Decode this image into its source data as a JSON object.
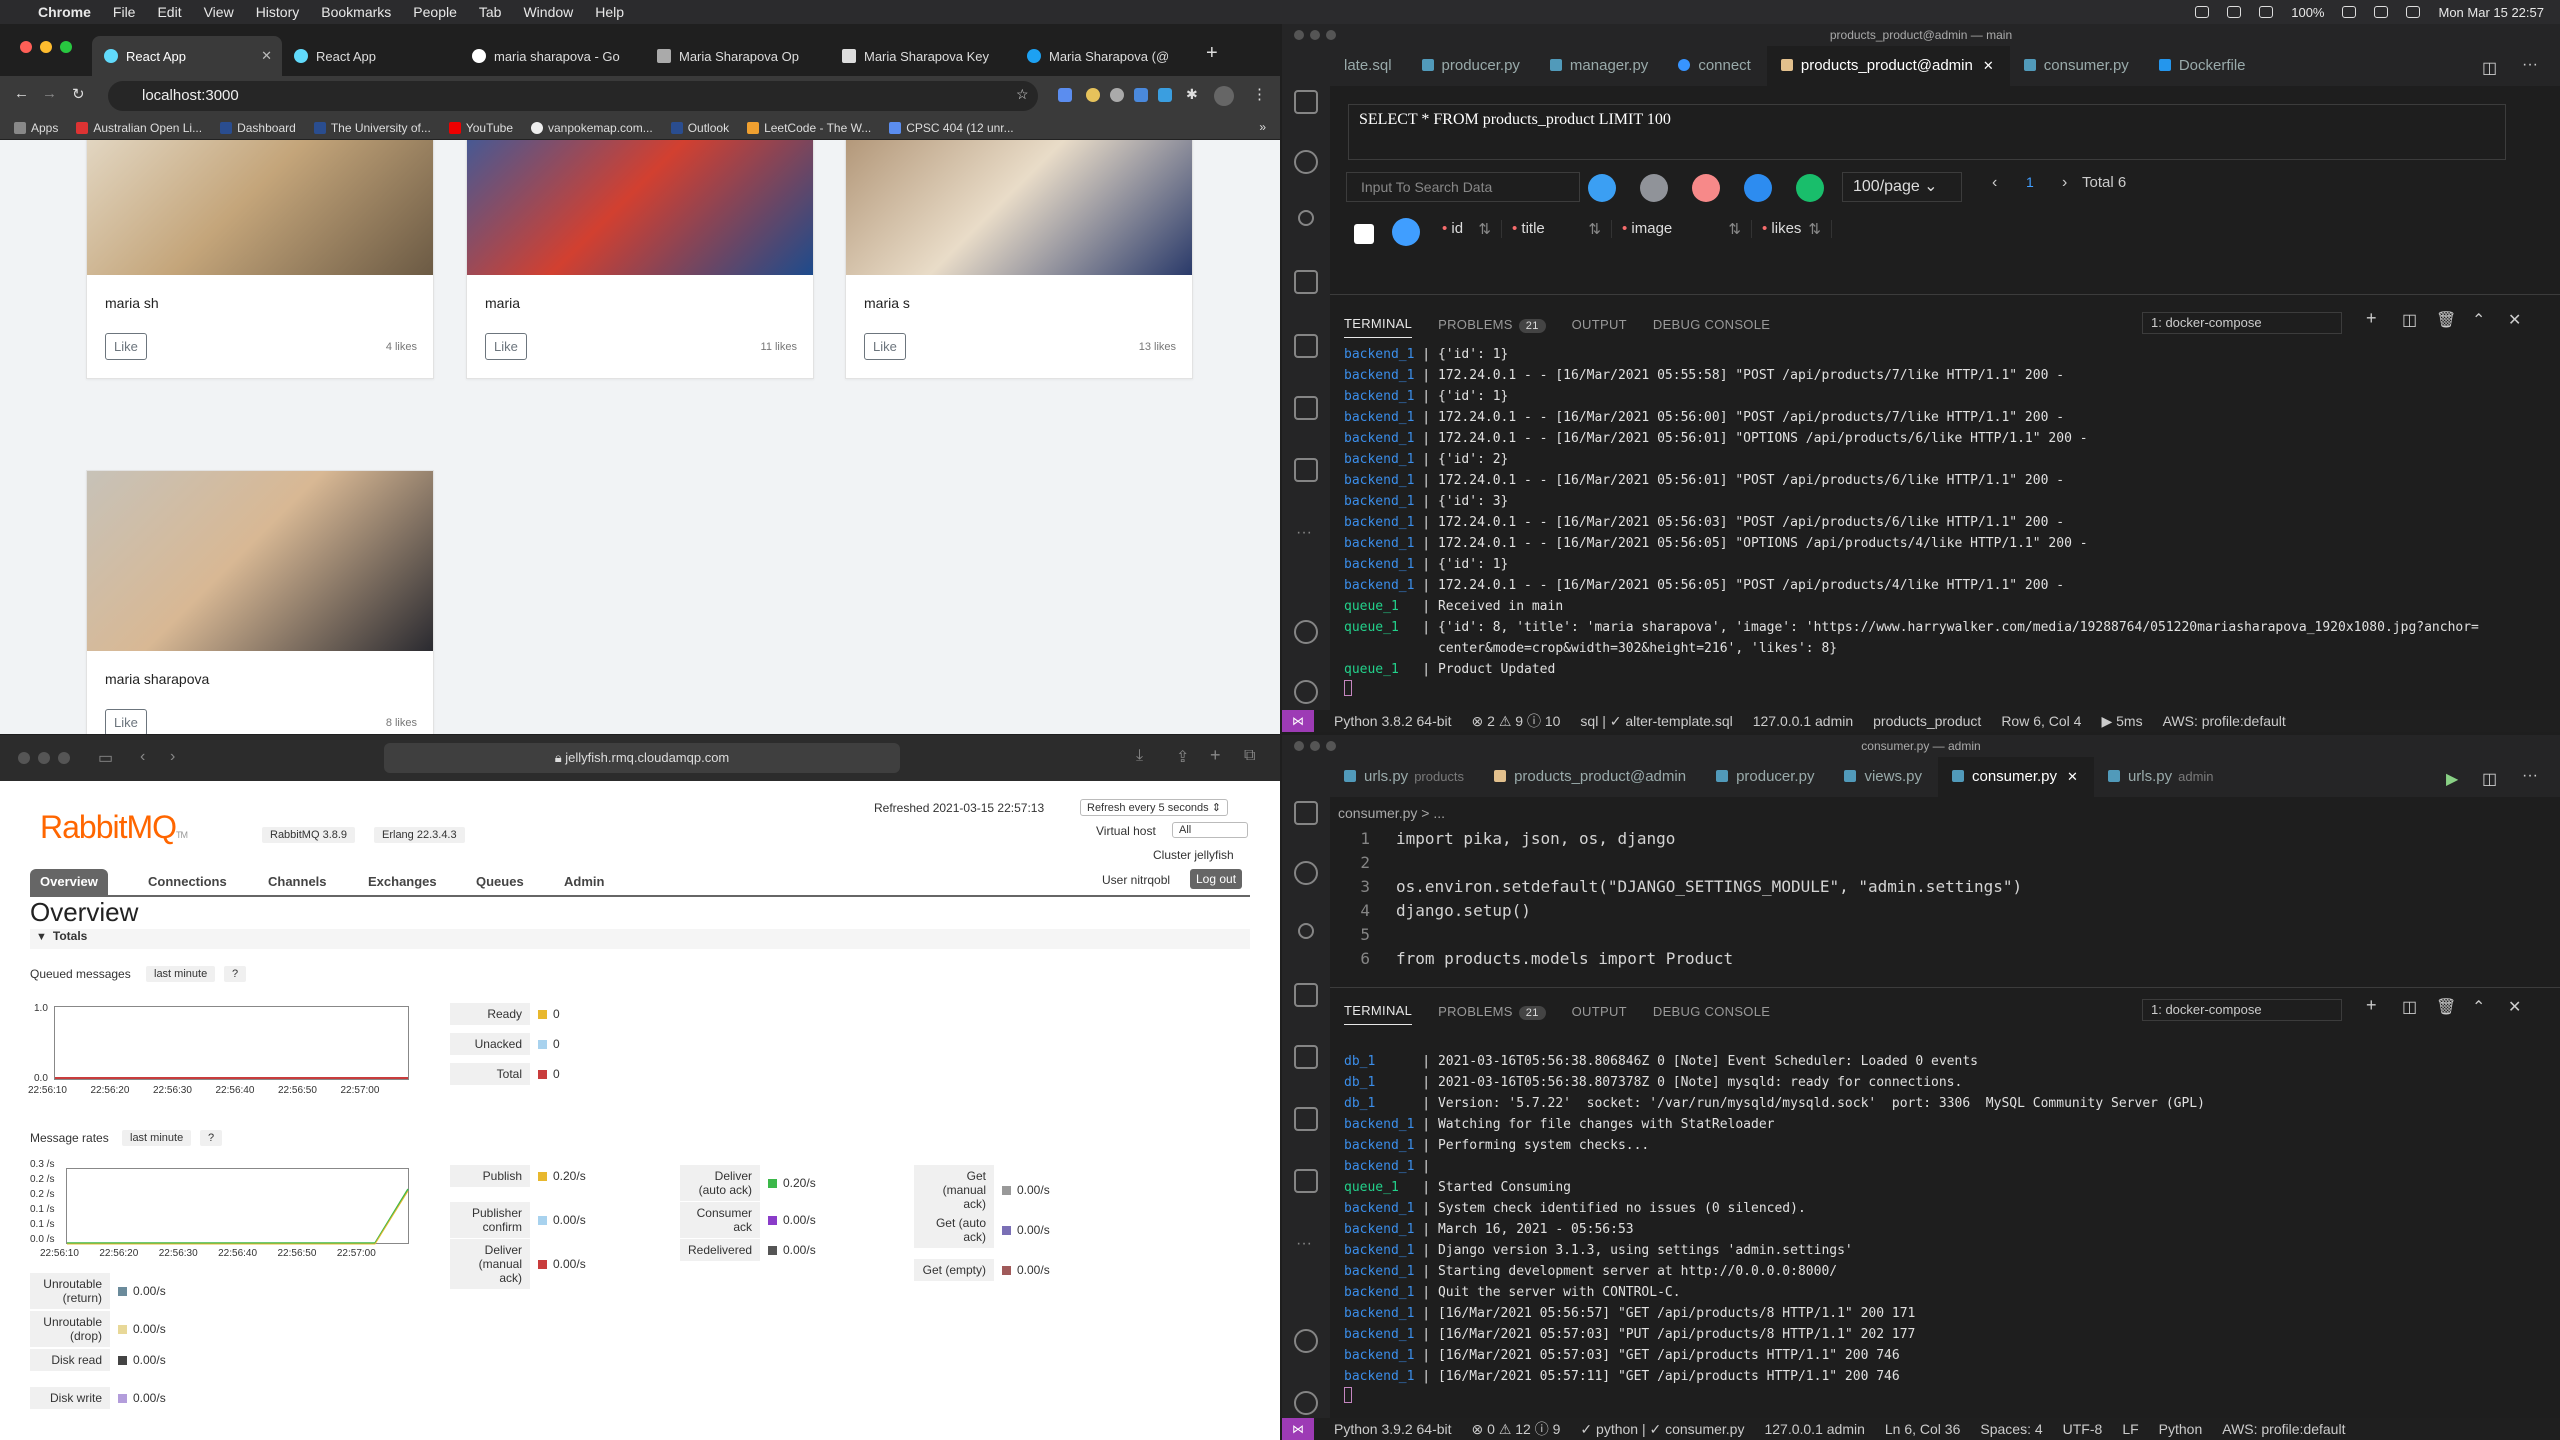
{
  "menubar": {
    "app": "Chrome",
    "items": [
      "File",
      "Edit",
      "View",
      "History",
      "Bookmarks",
      "People",
      "Tab",
      "Window",
      "Help"
    ],
    "battery": "100%",
    "datetime": "Mon Mar 15  22:57"
  },
  "chrome": {
    "tabs": [
      "React App",
      "React App",
      "maria sharapova - Go",
      "Maria Sharapova Op",
      "Maria Sharapova Key",
      "Maria Sharapova (@"
    ],
    "url": "localhost:3000",
    "bookmarks": [
      "Apps",
      "Australian Open Li...",
      "Dashboard",
      "The University of...",
      "YouTube",
      "vanpokemap.com...",
      "Outlook",
      "LeetCode - The W...",
      "CPSC 404 (12 unr..."
    ],
    "cards": [
      {
        "name": "maria sh",
        "likes": "4 likes",
        "button": "Like"
      },
      {
        "name": "maria",
        "likes": "11 likes",
        "button": "Like"
      },
      {
        "name": "maria s",
        "likes": "13 likes",
        "button": "Like"
      },
      {
        "name": "maria sharapova",
        "likes": "8 likes",
        "button": "Like"
      }
    ]
  },
  "rabbit": {
    "url": "jellyfish.rmq.cloudamqp.com",
    "logo": "RabbitMQ",
    "tm": "TM",
    "version": "RabbitMQ 3.8.9",
    "erlang": "Erlang 22.3.4.3",
    "refreshed": "Refreshed 2021-03-15 22:57:13",
    "refresh_every": "Refresh every 5 seconds",
    "vhost_label": "Virtual host",
    "vhost_value": "All",
    "cluster": "Cluster jellyfish",
    "user": "User nitrqobl",
    "logout": "Log out",
    "nav": [
      "Overview",
      "Connections",
      "Channels",
      "Exchanges",
      "Queues",
      "Admin"
    ],
    "heading": "Overview",
    "totals": "Totals",
    "queued_label": "Queued messages",
    "last_minute": "last minute",
    "q": "?",
    "qm_ymax": "1.0",
    "qm_ymin": "0.0",
    "xticks": [
      "22:56:10",
      "22:56:20",
      "22:56:30",
      "22:56:40",
      "22:56:50",
      "22:57:00"
    ],
    "queued": [
      {
        "k": "Ready",
        "v": "0",
        "c": "#e8b82e"
      },
      {
        "k": "Unacked",
        "v": "0",
        "c": "#a8d2ee"
      },
      {
        "k": "Total",
        "v": "0",
        "c": "#c93c3c"
      }
    ],
    "rates_label": "Message rates",
    "rate_yticks": [
      "0.3 /s",
      "0.2 /s",
      "0.2 /s",
      "0.1 /s",
      "0.1 /s",
      "0.0 /s"
    ],
    "rates_col1": [
      {
        "k": "Publish",
        "v": "0.20/s",
        "c": "#e8b82e"
      },
      {
        "k": "Publisher confirm",
        "v": "0.00/s",
        "c": "#a8d2ee"
      },
      {
        "k": "Deliver (manual ack)",
        "v": "0.00/s",
        "c": "#c93c3c"
      }
    ],
    "rates_col2": [
      {
        "k": "Deliver (auto ack)",
        "v": "0.20/s",
        "c": "#3cb84a"
      },
      {
        "k": "Consumer ack",
        "v": "0.00/s",
        "c": "#8a3cc9"
      },
      {
        "k": "Redelivered",
        "v": "0.00/s",
        "c": "#555555"
      }
    ],
    "rates_col3": [
      {
        "k": "Get (manual ack)",
        "v": "0.00/s",
        "c": "#999999"
      },
      {
        "k": "Get (auto ack)",
        "v": "0.00/s",
        "c": "#7a6fb5"
      },
      {
        "k": "Get (empty)",
        "v": "0.00/s",
        "c": "#a05a5a"
      }
    ],
    "rates_col0": [
      {
        "k": "Unroutable (return)",
        "v": "0.00/s",
        "c": "#6b8b9b"
      },
      {
        "k": "Unroutable (drop)",
        "v": "0.00/s",
        "c": "#e8d898"
      },
      {
        "k": "Disk read",
        "v": "0.00/s",
        "c": "#444444"
      },
      {
        "k": "Disk write",
        "v": "0.00/s",
        "c": "#b39ddb"
      }
    ]
  },
  "vs_top": {
    "title": "products_product@admin — main",
    "tabs": [
      {
        "label": "late.sql"
      },
      {
        "label": "producer.py"
      },
      {
        "label": "manager.py"
      },
      {
        "label": "connect"
      },
      {
        "label": "products_product@admin",
        "active": true
      },
      {
        "label": "consumer.py"
      },
      {
        "label": "Dockerfile"
      }
    ],
    "query": "SELECT * FROM products_product LIMIT 100",
    "search_placeholder": "Input To Search Data",
    "perpage": "100/page",
    "page": "1",
    "total": "Total 6",
    "columns": [
      "id",
      "title",
      "image",
      "likes"
    ],
    "panel_tabs": [
      "TERMINAL",
      "PROBLEMS",
      "OUTPUT",
      "DEBUG CONSOLE"
    ],
    "problems": "21",
    "terminal_select": "1: docker-compose",
    "lines": [
      {
        "s": "backend_1",
        "t": "{'id': 1}"
      },
      {
        "s": "backend_1",
        "t": "172.24.0.1 - - [16/Mar/2021 05:55:58] \"POST /api/products/7/like HTTP/1.1\" 200 -"
      },
      {
        "s": "backend_1",
        "t": "{'id': 1}"
      },
      {
        "s": "backend_1",
        "t": "172.24.0.1 - - [16/Mar/2021 05:56:00] \"POST /api/products/7/like HTTP/1.1\" 200 -"
      },
      {
        "s": "backend_1",
        "t": "172.24.0.1 - - [16/Mar/2021 05:56:01] \"OPTIONS /api/products/6/like HTTP/1.1\" 200 -"
      },
      {
        "s": "backend_1",
        "t": "{'id': 2}"
      },
      {
        "s": "backend_1",
        "t": "172.24.0.1 - - [16/Mar/2021 05:56:01] \"POST /api/products/6/like HTTP/1.1\" 200 -"
      },
      {
        "s": "backend_1",
        "t": "{'id': 3}"
      },
      {
        "s": "backend_1",
        "t": "172.24.0.1 - - [16/Mar/2021 05:56:03] \"POST /api/products/6/like HTTP/1.1\" 200 -"
      },
      {
        "s": "backend_1",
        "t": "172.24.0.1 - - [16/Mar/2021 05:56:05] \"OPTIONS /api/products/4/like HTTP/1.1\" 200 -"
      },
      {
        "s": "backend_1",
        "t": "{'id': 1}"
      },
      {
        "s": "backend_1",
        "t": "172.24.0.1 - - [16/Mar/2021 05:56:05] \"POST /api/products/4/like HTTP/1.1\" 200 -"
      },
      {
        "s": "queue_1",
        "t": "Received in main"
      },
      {
        "s": "queue_1",
        "t": "{'id': 8, 'title': 'maria sharapova', 'image': 'https://www.harrywalker.com/media/19288764/051220mariasharapova_1920x1080.jpg?anchor="
      },
      {
        "s": "",
        "t": "center&mode=crop&width=302&height=216', 'likes': 8}"
      },
      {
        "s": "queue_1",
        "t": "Product Updated"
      }
    ],
    "status": [
      "Python 3.8.2 64-bit",
      "⊗ 2 ⚠ 9 ⓘ 10",
      "sql | ✓ alter-template.sql",
      "127.0.0.1  admin",
      "products_product",
      "Row 6, Col 4",
      "▶ 5ms",
      "AWS: profile:default"
    ]
  },
  "vs_bot": {
    "title": "consumer.py — admin",
    "tabs": [
      {
        "label": "urls.py",
        "dim": "products"
      },
      {
        "label": "products_product@admin"
      },
      {
        "label": "producer.py"
      },
      {
        "label": "views.py"
      },
      {
        "label": "consumer.py",
        "active": true
      },
      {
        "label": "urls.py",
        "dim": "admin"
      }
    ],
    "breadcrumb": "consumer.py > ...",
    "code": [
      {
        "n": "1",
        "t": "import pika, json, os, django"
      },
      {
        "n": "2",
        "t": ""
      },
      {
        "n": "3",
        "t": "os.environ.setdefault(\"DJANGO_SETTINGS_MODULE\", \"admin.settings\")"
      },
      {
        "n": "4",
        "t": "django.setup()"
      },
      {
        "n": "5",
        "t": ""
      },
      {
        "n": "6",
        "t": "from products.models import Product"
      }
    ],
    "panel_tabs": [
      "TERMINAL",
      "PROBLEMS",
      "OUTPUT",
      "DEBUG CONSOLE"
    ],
    "problems": "21",
    "terminal_select": "1: docker-compose",
    "lines": [
      {
        "s": "db_1",
        "t": "2021-03-16T05:56:38.806846Z 0 [Note] Event Scheduler: Loaded 0 events"
      },
      {
        "s": "db_1",
        "t": "2021-03-16T05:56:38.807378Z 0 [Note] mysqld: ready for connections."
      },
      {
        "s": "db_1",
        "t": "Version: '5.7.22'  socket: '/var/run/mysqld/mysqld.sock'  port: 3306  MySQL Community Server (GPL)"
      },
      {
        "s": "backend_1",
        "t": "Watching for file changes with StatReloader"
      },
      {
        "s": "backend_1",
        "t": "Performing system checks..."
      },
      {
        "s": "backend_1",
        "t": ""
      },
      {
        "s": "queue_1",
        "t": "Started Consuming"
      },
      {
        "s": "backend_1",
        "t": "System check identified no issues (0 silenced)."
      },
      {
        "s": "backend_1",
        "t": "March 16, 2021 - 05:56:53"
      },
      {
        "s": "backend_1",
        "t": "Django version 3.1.3, using settings 'admin.settings'"
      },
      {
        "s": "backend_1",
        "t": "Starting development server at http://0.0.0.0:8000/"
      },
      {
        "s": "backend_1",
        "t": "Quit the server with CONTROL-C."
      },
      {
        "s": "backend_1",
        "t": "[16/Mar/2021 05:56:57] \"GET /api/products/8 HTTP/1.1\" 200 171"
      },
      {
        "s": "backend_1",
        "t": "[16/Mar/2021 05:57:03] \"PUT /api/products/8 HTTP/1.1\" 202 177"
      },
      {
        "s": "backend_1",
        "t": "[16/Mar/2021 05:57:03] \"GET /api/products HTTP/1.1\" 200 746"
      },
      {
        "s": "backend_1",
        "t": "[16/Mar/2021 05:57:11] \"GET /api/products HTTP/1.1\" 200 746"
      }
    ],
    "status": [
      "Python 3.9.2 64-bit",
      "⊗ 0 ⚠ 12 ⓘ 9",
      "✓ python | ✓ consumer.py",
      "127.0.0.1  admin",
      "Ln 6, Col 36",
      "Spaces: 4",
      "UTF-8",
      "LF",
      "Python",
      "AWS: profile:default"
    ]
  }
}
